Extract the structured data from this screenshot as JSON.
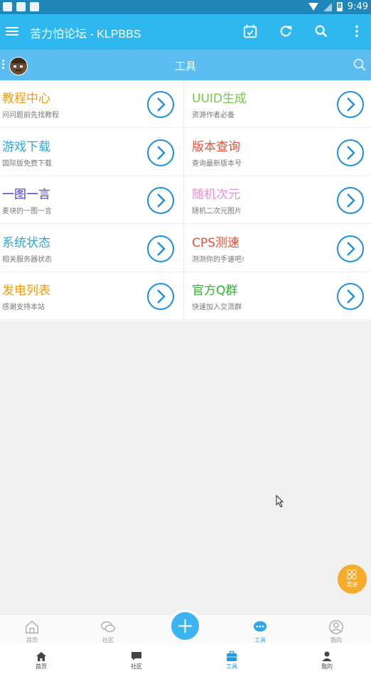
{
  "status_bar": {
    "time": "9:49",
    "battery_text": "8"
  },
  "app_bar": {
    "title": "苦力怕论坛 - KLPBBS"
  },
  "sub_bar": {
    "title": "工具"
  },
  "tools": [
    {
      "title": "教程中心",
      "subtitle": "问问题前先找教程",
      "color": "#f39c12"
    },
    {
      "title": "UUID生成",
      "subtitle": "资源作者必备",
      "color": "#7ac74f"
    },
    {
      "title": "游戏下载",
      "subtitle": "国际版免费下载",
      "color": "#29a8e0"
    },
    {
      "title": "版本查询",
      "subtitle": "查询最新版本号",
      "color": "#e8503a"
    },
    {
      "title": "一图一言",
      "subtitle": "麦块的一图一言",
      "color": "#3f3fc4"
    },
    {
      "title": "随机次元",
      "subtitle": "随机二次元图片",
      "color": "#f08be0"
    },
    {
      "title": "系统状态",
      "subtitle": "相关服务器状态",
      "color": "#29a8e0"
    },
    {
      "title": "CPS测速",
      "subtitle": "测测你的手速吧!",
      "color": "#e8503a"
    },
    {
      "title": "发电列表",
      "subtitle": "感谢支持本站",
      "color": "#f39c12"
    },
    {
      "title": "官方Q群",
      "subtitle": "快速加入交流群",
      "color": "#2fb52f"
    }
  ],
  "fab_menu": {
    "label": "菜单"
  },
  "nav_top": [
    {
      "label": "首页",
      "icon": "home-outline-icon"
    },
    {
      "label": "社区",
      "icon": "chat-bubbles-icon"
    },
    {
      "label": "工具",
      "icon": "chat-dots-icon",
      "active": true
    },
    {
      "label": "我的",
      "icon": "user-circle-icon"
    }
  ],
  "nav_bottom": [
    {
      "label": "首页",
      "icon": "home-icon"
    },
    {
      "label": "社区",
      "icon": "comment-icon"
    },
    {
      "label": "工具",
      "icon": "briefcase-icon",
      "active": true
    },
    {
      "label": "我的",
      "icon": "person-icon"
    }
  ],
  "colors": {
    "accent": "#2fb8f0",
    "fab_orange": "#f6ab2b",
    "arrow_blue": "#1b8fe0"
  }
}
